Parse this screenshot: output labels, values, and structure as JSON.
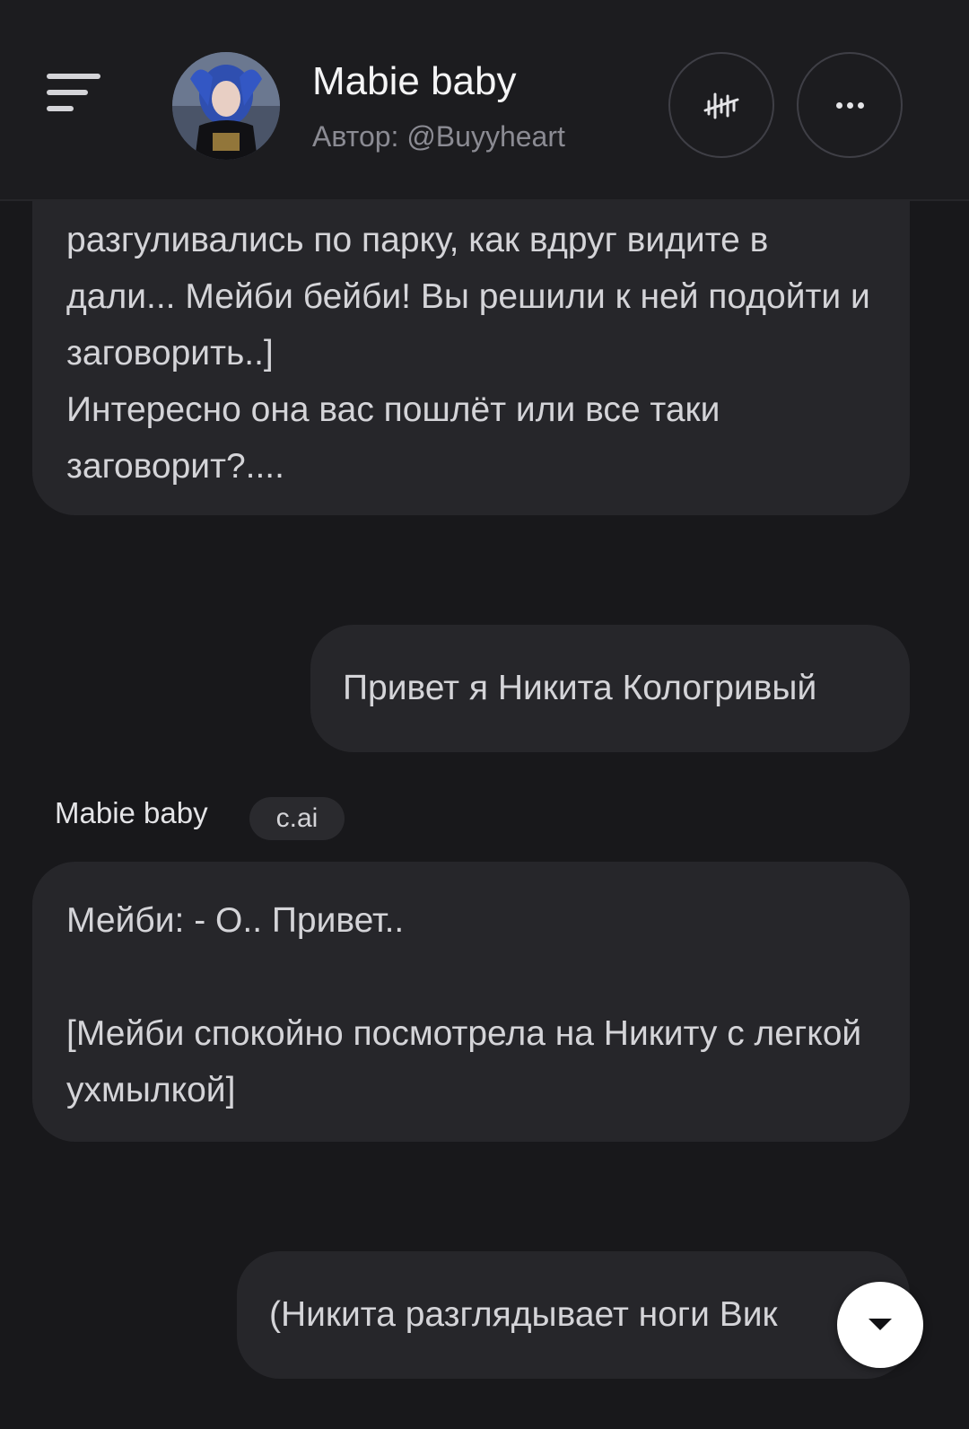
{
  "header": {
    "title": "Mabie baby",
    "author": "Автор: @Buyyheart",
    "menu_icon": "hamburger-icon",
    "voice_icon": "voice-waveform-off-icon",
    "more_icon": "more-horizontal-icon"
  },
  "messages": {
    "greeting_tail": "разгуливались по парку, как вдруг видите в дали... Мейби бейби! Вы решили к ней подойти и заговорить..]\nИнтересно она вас пошлёт или все таки заговорит?....",
    "user_1": "Привет я Никита Кологривый",
    "bot_name": "Mabie baby",
    "bot_badge": "c.ai",
    "bot_1": "Мейби: - О.. Привет..\n\n[Мейби спокойно посмотрела на Никиту с легкой ухмылкой]",
    "user_2": "(Никита разглядывает ноги Вик"
  },
  "controls": {
    "scroll_down_icon": "chevron-down-icon"
  },
  "colors": {
    "background": "#18181b",
    "bubble": "#26262a",
    "text": "#d4d4d8",
    "muted": "#8b8b93"
  }
}
